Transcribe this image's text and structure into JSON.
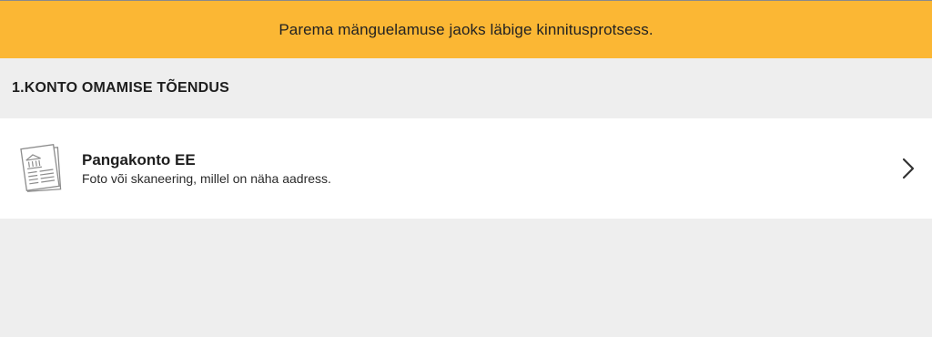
{
  "banner": {
    "message": "Parema mänguelamuse jaoks läbige kinnitusprotsess."
  },
  "section": {
    "title": "1.KONTO OMAMISE TÕENDUS"
  },
  "document_option": {
    "title": "Pangakonto EE",
    "subtitle": "Foto või skaneering, millel on näha aadress.",
    "icon": "bank-document-icon",
    "action_icon": "chevron-right-icon"
  },
  "colors": {
    "banner_bg": "#fbb734",
    "page_bg": "#eeeeee",
    "card_bg": "#ffffff"
  }
}
